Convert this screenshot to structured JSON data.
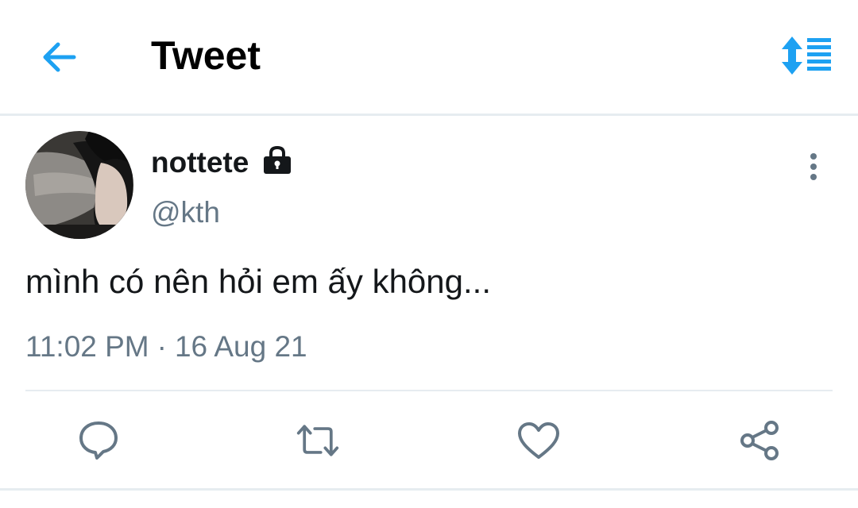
{
  "header": {
    "title": "Tweet",
    "back_icon": "arrow-left-icon",
    "sort_icon": "sort-lines-icon",
    "accent_color": "#1da1f2"
  },
  "tweet": {
    "author": {
      "display_name": "nottete",
      "handle": "@kth",
      "protected": true
    },
    "text": "mình có nên hỏi em ấy không...",
    "time": "11:02 PM",
    "separator": "·",
    "date": "16 Aug 21"
  },
  "actions": [
    {
      "name": "reply",
      "icon": "speech-bubble-icon"
    },
    {
      "name": "retweet",
      "icon": "retweet-icon"
    },
    {
      "name": "like",
      "icon": "heart-icon"
    },
    {
      "name": "share",
      "icon": "share-icon"
    }
  ],
  "colors": {
    "text_primary": "#14171a",
    "text_secondary": "#657786",
    "divider": "#e6ecf0",
    "icon_gray": "#657786"
  }
}
